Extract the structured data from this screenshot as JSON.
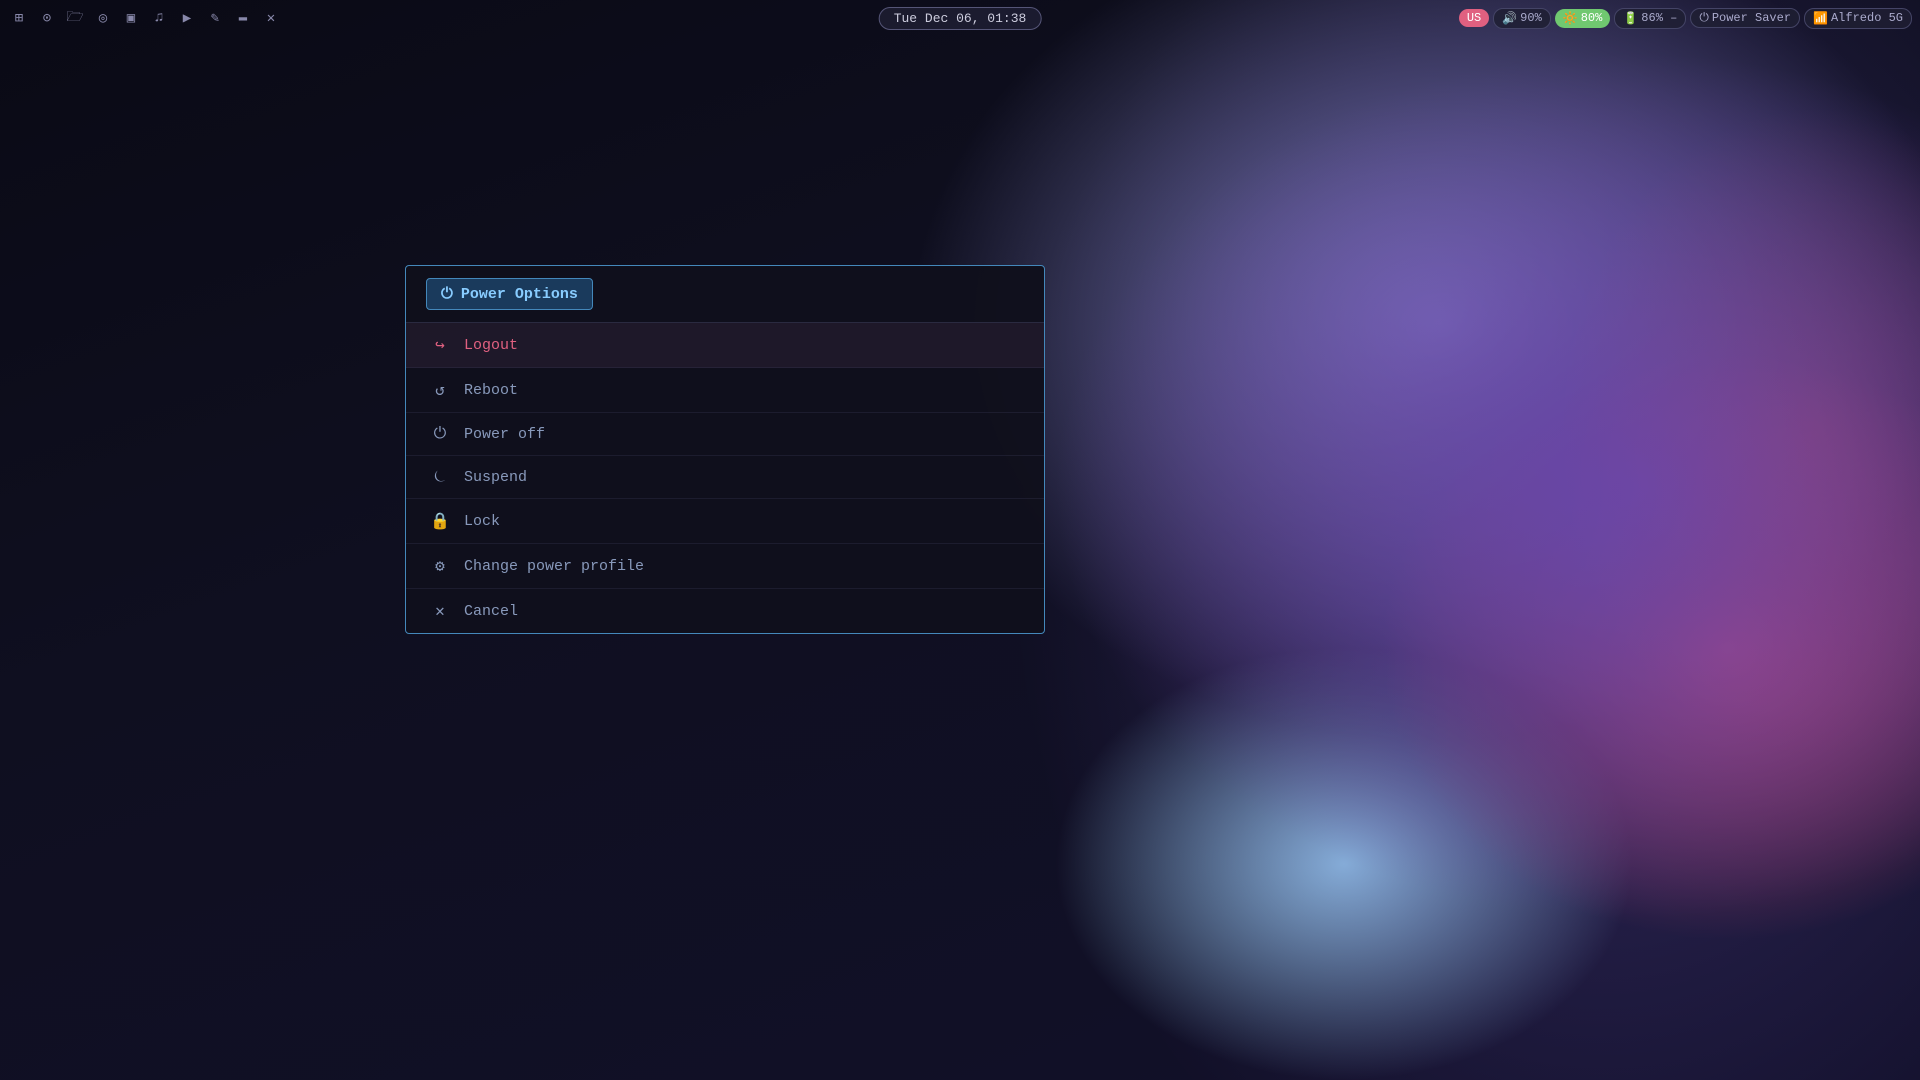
{
  "topbar": {
    "icons": [
      {
        "name": "grid-icon",
        "glyph": "⊞"
      },
      {
        "name": "arch-icon",
        "glyph": "⊙"
      },
      {
        "name": "folder-icon",
        "glyph": "🗁"
      },
      {
        "name": "firefox-icon",
        "glyph": "◉"
      },
      {
        "name": "chat-icon",
        "glyph": "💬"
      },
      {
        "name": "music-icon",
        "glyph": "♪"
      },
      {
        "name": "video-icon",
        "glyph": "▶"
      },
      {
        "name": "edit-icon",
        "glyph": "✎"
      },
      {
        "name": "terminal-icon",
        "glyph": "▬"
      },
      {
        "name": "settings-icon",
        "glyph": "✕"
      }
    ],
    "clock": "Tue Dec 06, 01:38",
    "status": {
      "keyboard": "US",
      "volume": "🔊 90%",
      "brightness": "🔆 80%",
      "battery": "🔋 86% –",
      "power_mode": "Power Saver",
      "wifi": "📶 Alfredo 5G"
    }
  },
  "dialog": {
    "title_icon": "⏻",
    "title": "Power Options",
    "items": [
      {
        "id": "logout",
        "icon": "↪",
        "label": "Logout",
        "active": true,
        "color": "logout"
      },
      {
        "id": "reboot",
        "icon": "↺",
        "label": "Reboot",
        "active": false,
        "color": "normal"
      },
      {
        "id": "poweroff",
        "icon": "⏻",
        "label": "Power off",
        "active": false,
        "color": "normal"
      },
      {
        "id": "suspend",
        "icon": "⏾",
        "label": "Suspend",
        "active": false,
        "color": "normal"
      },
      {
        "id": "lock",
        "icon": "🔒",
        "label": "Lock",
        "active": false,
        "color": "normal"
      },
      {
        "id": "profile",
        "icon": "⚙",
        "label": "Change power profile",
        "active": false,
        "color": "normal"
      },
      {
        "id": "cancel",
        "icon": "✕",
        "label": "Cancel",
        "active": false,
        "color": "normal"
      }
    ]
  }
}
